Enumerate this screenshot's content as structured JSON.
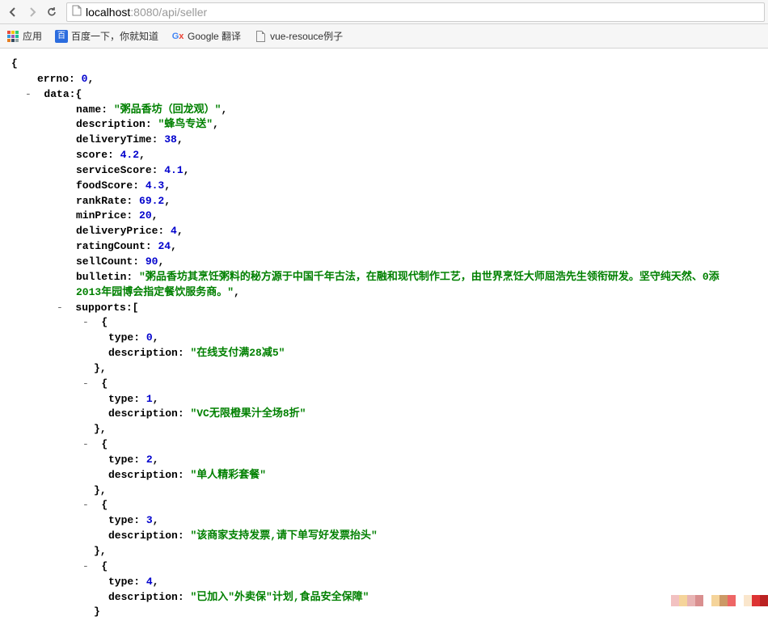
{
  "toolbar": {
    "url_host": "localhost",
    "url_port_path": ":8080/api/seller"
  },
  "bookmarks": {
    "apps": "应用",
    "baidu": "百度一下，你就知道",
    "google": "Google 翻译",
    "vue": "vue-resouce例子"
  },
  "json": {
    "errno_key": "errno:",
    "errno_val": "0",
    "data_key": "data:",
    "name_key": "name:",
    "name_val": "\"粥品香坊（回龙观）\"",
    "description_key": "description:",
    "description_val": "\"蜂鸟专送\"",
    "deliveryTime_key": "deliveryTime:",
    "deliveryTime_val": "38",
    "score_key": "score:",
    "score_val": "4.2",
    "serviceScore_key": "serviceScore:",
    "serviceScore_val": "4.1",
    "foodScore_key": "foodScore:",
    "foodScore_val": "4.3",
    "rankRate_key": "rankRate:",
    "rankRate_val": "69.2",
    "minPrice_key": "minPrice:",
    "minPrice_val": "20",
    "deliveryPrice_key": "deliveryPrice:",
    "deliveryPrice_val": "4",
    "ratingCount_key": "ratingCount:",
    "ratingCount_val": "24",
    "sellCount_key": "sellCount:",
    "sellCount_val": "90",
    "bulletin_key": "bulletin:",
    "bulletin_val_l1": "\"粥品香坊其烹饪粥料的秘方源于中国千年古法，在融和现代制作工艺，由世界烹饪大师屈浩先生领衔研发。坚守纯天然、0添",
    "bulletin_val_l2": "2013年园博会指定餐饮服务商。\"",
    "supports_key": "supports:",
    "s_type_key": "type:",
    "s_desc_key": "description:",
    "s0_type": "0",
    "s0_desc": "\"在线支付满28减5\"",
    "s1_type": "1",
    "s1_desc": "\"VC无限橙果汁全场8折\"",
    "s2_type": "2",
    "s2_desc": "\"单人精彩套餐\"",
    "s3_type": "3",
    "s3_desc": "\"该商家支持发票,请下单写好发票抬头\"",
    "s4_type": "4",
    "s4_desc": "\"已加入\"外卖保\"计划,食品安全保障\""
  }
}
